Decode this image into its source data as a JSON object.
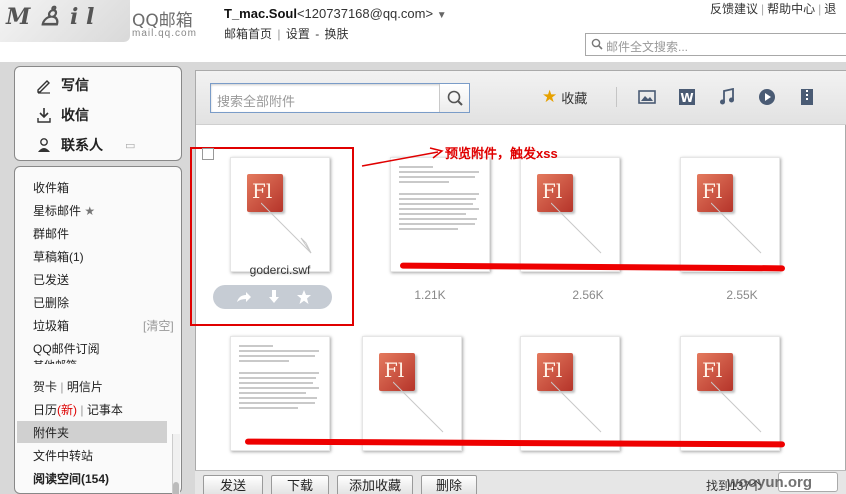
{
  "header": {
    "logo_title": "QQ邮箱",
    "logo_url": "mail.qq.com",
    "user_name": "T_mac.Soul",
    "user_email": "<120737168@qq.com>",
    "nav": [
      "邮箱首页",
      "设置",
      "换肤"
    ],
    "nav_sep": "|",
    "nav_sep2": "-",
    "right_links": [
      "反馈建议",
      "帮助中心",
      "退"
    ],
    "search_placeholder": "邮件全文搜索..."
  },
  "sidebar": {
    "actions": [
      "写信",
      "收信",
      "联系人"
    ],
    "folders": {
      "inbox": "收件箱",
      "starred": "星标邮件",
      "group": "群邮件",
      "drafts": "草稿箱(1)",
      "sent": "已发送",
      "deleted": "已删除",
      "spam": "垃圾箱",
      "spam_clear": "[清空]",
      "subscribe": "QQ邮件订阅",
      "other": "其他邮箱",
      "card": "贺卡",
      "postcard": "明信片",
      "calendar": "日历",
      "calendar_new": "(新)",
      "notes": "记事本",
      "attachments": "附件夹",
      "transfer": "文件中转站",
      "reading": "阅读空间(154)"
    }
  },
  "toolbar": {
    "search_placeholder": "搜索全部附件",
    "favorites": "收藏",
    "icons": [
      "image-icon",
      "word-icon",
      "music-icon",
      "video-icon",
      "archive-icon"
    ]
  },
  "attachments": [
    {
      "name": "goderci.swf",
      "size": "",
      "type": "flash"
    },
    {
      "name": "",
      "size": "1.21K",
      "type": "html"
    },
    {
      "name": "",
      "size": "2.56K",
      "type": "flash"
    },
    {
      "name": "",
      "size": "2.55K",
      "type": "flash"
    },
    {
      "name": "",
      "size": "",
      "type": "html"
    },
    {
      "name": "",
      "size": "",
      "type": "flash"
    },
    {
      "name": "",
      "size": "",
      "type": "flash"
    },
    {
      "name": "",
      "size": "",
      "type": "flash"
    }
  ],
  "annotation": "预览附件，触发xss",
  "actions": {
    "forward": "forward-icon",
    "download": "download-icon",
    "star": "star-icon"
  },
  "bottom": {
    "buttons": [
      "发送",
      "下载",
      "添加收藏",
      "删除"
    ],
    "status": "找到137个",
    "watermark": "wooyun.org"
  },
  "colors": {
    "accent_red": "#e00000",
    "flash_red": "#c4392b",
    "frame_gray": "#d8d8d8"
  }
}
